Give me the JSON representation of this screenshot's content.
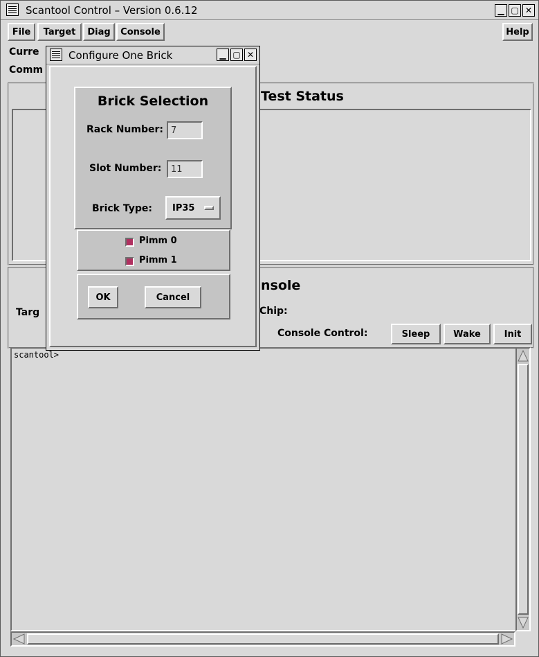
{
  "window": {
    "title": "Scantool Control –  Version 0.6.12"
  },
  "menubar": {
    "items": [
      "File",
      "Target",
      "Diag",
      "Console"
    ],
    "help": "Help"
  },
  "info": {
    "current_label": "Curre",
    "command_label": "Comm"
  },
  "test_status": {
    "heading": "Test Status"
  },
  "console_section": {
    "heading_partial": "nsole",
    "target_label": "Targ",
    "chip_label": "Chip:",
    "control_label": "Console Control:",
    "buttons": {
      "sleep": "Sleep",
      "wake": "Wake",
      "init": "Init"
    },
    "text": "scantool>"
  },
  "dialog": {
    "title": "Configure One Brick",
    "heading": "Brick Selection",
    "rack_label": "Rack Number:",
    "rack_value": "7",
    "slot_label": "Slot Number:",
    "slot_value": "11",
    "brick_type_label": "Brick Type:",
    "brick_type_value": "IP35",
    "pimm0_label": "Pimm 0",
    "pimm1_label": "Pimm 1",
    "pimm0_checked": true,
    "pimm1_checked": true,
    "ok_label": "OK",
    "cancel_label": "Cancel"
  },
  "colors": {
    "checkbox_on": "#b03060",
    "background": "#d9d9d9",
    "panel": "#c4c4c4"
  }
}
